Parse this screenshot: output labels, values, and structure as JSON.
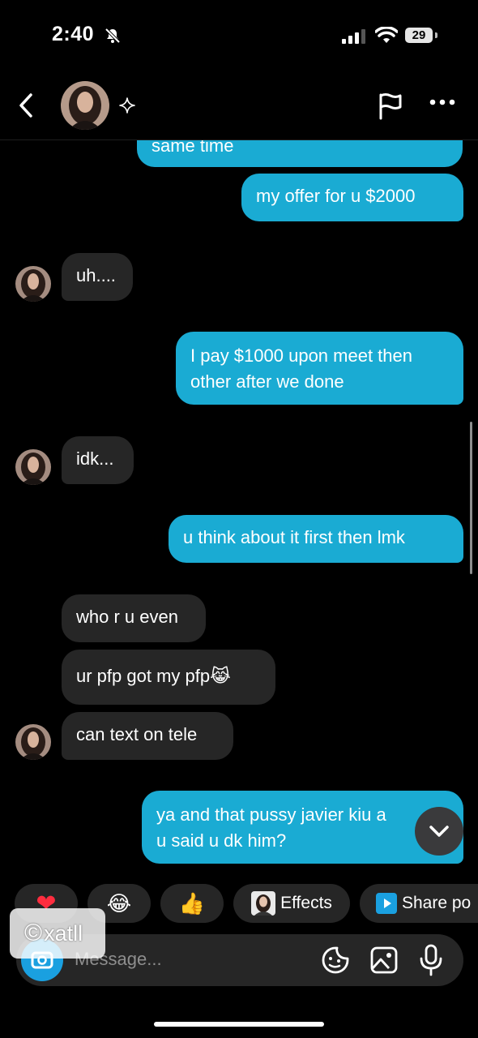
{
  "status_bar": {
    "time": "2:40",
    "battery": "29"
  },
  "messages": [
    {
      "dir": "out",
      "text": "same time"
    },
    {
      "dir": "out",
      "text": "my offer for u $2000"
    },
    {
      "dir": "in",
      "text": "uh...."
    },
    {
      "dir": "out",
      "text": "I pay $1000 upon meet then",
      "text2": "other after we done"
    },
    {
      "dir": "in",
      "text": "idk..."
    },
    {
      "dir": "out",
      "text": "u think about it first then lmk"
    },
    {
      "dir": "in",
      "text": "who r u even"
    },
    {
      "dir": "in",
      "text": "ur pfp got my pfp",
      "emoji": "😹"
    },
    {
      "dir": "in",
      "text": "can text on tele"
    },
    {
      "dir": "out",
      "text": "ya and that pussy javier kiu a",
      "text2": "u said u dk him?"
    }
  ],
  "quick_actions": [
    {
      "icon": "heart-icon",
      "glyph": "❤"
    },
    {
      "icon": "laughing-emoji-icon",
      "glyph": "😂"
    },
    {
      "icon": "thumbs-up-icon",
      "glyph": "👍"
    },
    {
      "icon": "effects-icon",
      "label": "Effects"
    },
    {
      "icon": "share-icon",
      "label": "Share po"
    }
  ],
  "composer": {
    "placeholder": "Message..."
  },
  "watermark": {
    "text": "xatll",
    "symbol": "©"
  },
  "colors": {
    "outgoing_bubble": "#1aabd3",
    "incoming_bubble": "#262626",
    "background": "#000000"
  }
}
